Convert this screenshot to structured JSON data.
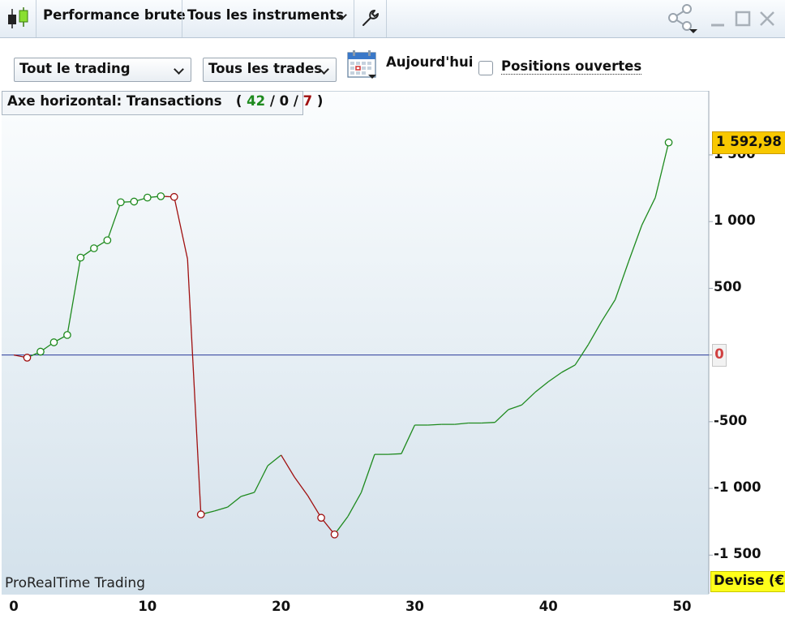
{
  "window": {
    "title": "Performance brute",
    "instruments_selector": "Tous les instruments"
  },
  "toolbar": {
    "trading_filter": "Tout le trading",
    "trades_filter": "Tous les trades",
    "date_label": "Aujourd'hui",
    "open_positions_label": "Positions ouvertes",
    "open_positions_checked": false
  },
  "axis_info": {
    "label": "Axe horizontal: Transactions",
    "open_paren": "(",
    "winning": "42",
    "sep1": "/",
    "neutral": "0",
    "sep2": "/",
    "losing": "7",
    "close_paren": ")"
  },
  "watermark": "ProRealTime Trading",
  "badges": {
    "last_value": "1 592,98",
    "zero_value": "0",
    "currency": "Devise (€)"
  },
  "colors": {
    "gain": "#1e8a1e",
    "loss": "#a01010",
    "baseline": "#2a3a9a",
    "last_badge": "#f8c800",
    "currency_badge": "#ffff1a"
  },
  "chart_data": {
    "type": "line",
    "x_ticks": [
      "0",
      "10",
      "20",
      "30",
      "40",
      "50"
    ],
    "y_ticks": [
      "1 500",
      "1 000",
      "500",
      "0",
      "-500",
      "-1 000",
      "-1 500"
    ],
    "xlim": [
      0,
      52
    ],
    "ylim": [
      -1790,
      1980
    ],
    "baseline": 0,
    "series": [
      {
        "values": [
          {
            "x": 0,
            "y": 0
          },
          {
            "x": 1,
            "y": -20
          },
          {
            "x": 2,
            "y": 25
          },
          {
            "x": 3,
            "y": 95
          },
          {
            "x": 4,
            "y": 150
          },
          {
            "x": 5,
            "y": 730
          },
          {
            "x": 6,
            "y": 800
          },
          {
            "x": 7,
            "y": 860
          },
          {
            "x": 8,
            "y": 1145
          },
          {
            "x": 9,
            "y": 1150
          },
          {
            "x": 10,
            "y": 1180
          },
          {
            "x": 11,
            "y": 1190
          },
          {
            "x": 12,
            "y": 1185
          },
          {
            "x": 13,
            "y": 720
          },
          {
            "x": 14,
            "y": -1195
          },
          {
            "x": 15,
            "y": -1170
          },
          {
            "x": 16,
            "y": -1140
          },
          {
            "x": 17,
            "y": -1060
          },
          {
            "x": 18,
            "y": -1030
          },
          {
            "x": 19,
            "y": -830
          },
          {
            "x": 20,
            "y": -750
          },
          {
            "x": 21,
            "y": -915
          },
          {
            "x": 22,
            "y": -1055
          },
          {
            "x": 23,
            "y": -1220
          },
          {
            "x": 24,
            "y": -1345
          },
          {
            "x": 25,
            "y": -1210
          },
          {
            "x": 26,
            "y": -1030
          },
          {
            "x": 27,
            "y": -745
          },
          {
            "x": 28,
            "y": -745
          },
          {
            "x": 29,
            "y": -740
          },
          {
            "x": 30,
            "y": -525
          },
          {
            "x": 31,
            "y": -525
          },
          {
            "x": 32,
            "y": -520
          },
          {
            "x": 33,
            "y": -520
          },
          {
            "x": 34,
            "y": -510
          },
          {
            "x": 35,
            "y": -510
          },
          {
            "x": 36,
            "y": -505
          },
          {
            "x": 37,
            "y": -410
          },
          {
            "x": 38,
            "y": -375
          },
          {
            "x": 39,
            "y": -280
          },
          {
            "x": 40,
            "y": -200
          },
          {
            "x": 41,
            "y": -130
          },
          {
            "x": 42,
            "y": -75
          },
          {
            "x": 43,
            "y": 80
          },
          {
            "x": 44,
            "y": 255
          },
          {
            "x": 45,
            "y": 415
          },
          {
            "x": 46,
            "y": 700
          },
          {
            "x": 47,
            "y": 975
          },
          {
            "x": 48,
            "y": 1180
          },
          {
            "x": 49,
            "y": 1592.98
          }
        ],
        "markers_at_x": [
          1,
          2,
          3,
          4,
          5,
          6,
          7,
          8,
          9,
          10,
          11,
          12,
          14,
          23,
          24,
          49
        ]
      }
    ]
  }
}
